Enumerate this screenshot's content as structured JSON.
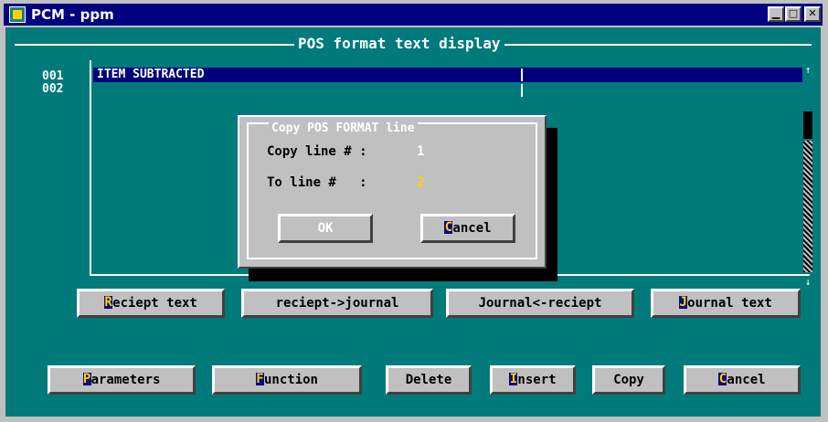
{
  "window": {
    "title": "PCM - ppm",
    "controls": {
      "minimize": "▁",
      "maximize": "□",
      "close": "✕"
    }
  },
  "frame": {
    "title": "POS format text display"
  },
  "list": {
    "line_numbers": [
      "001",
      "002"
    ],
    "rows": [
      "ITEM SUBTRACTED",
      ""
    ]
  },
  "scrollbar": {
    "up": "↑",
    "down": "↓"
  },
  "dialog": {
    "title": "Copy POS FORMAT line",
    "copy_label": "Copy line # :",
    "copy_value": "1",
    "to_label": "To line #   :",
    "to_value": "2",
    "ok_label": "OK",
    "cancel_hotkey": "C",
    "cancel_rest": "ancel"
  },
  "row1_buttons": [
    {
      "hotkey": "R",
      "rest": "eciept text"
    },
    {
      "hotkey": "",
      "rest": "reciept->journal"
    },
    {
      "hotkey": "",
      "rest": "Journal<-reciept"
    },
    {
      "hotkey": "J",
      "rest": "ournal text"
    }
  ],
  "row2_buttons": [
    {
      "hotkey": "P",
      "rest": "arameters"
    },
    {
      "hotkey": "F",
      "rest": "unction"
    },
    {
      "hotkey": "",
      "rest": "Delete"
    },
    {
      "hotkey": "I",
      "rest": "nsert"
    },
    {
      "hotkey": "",
      "rest": "Copy"
    },
    {
      "hotkey": "C",
      "rest": "ancel"
    }
  ],
  "colors": {
    "background": "#007a7a",
    "selection": "#00007a",
    "hotkey": "#ffd400",
    "titlebar": "#000080"
  }
}
